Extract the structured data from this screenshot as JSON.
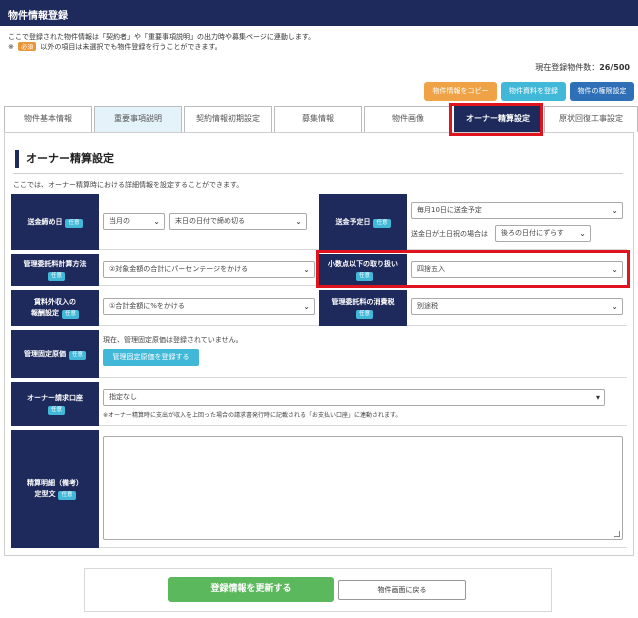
{
  "window": {
    "title": "物件情報登録"
  },
  "notes": {
    "line1": "ここで登録された物件情報は「契約者」や「重要事項説明」の出力時や募集ページに連動します。",
    "line2_prefix": "※",
    "required_badge": "必須",
    "line2_suffix": "以外の項目は未選択でも物件登録を行うことができます。"
  },
  "count": {
    "label": "現在登録物件数：",
    "value": "26/500"
  },
  "top_buttons": {
    "copy": "物件情報をコピー",
    "register": "物件資料を登録",
    "authority": "物件の権限設定"
  },
  "tabs": [
    "物件基本情報",
    "重要事項説明",
    "契約情報初期設定",
    "募集情報",
    "物件画像",
    "オーナー精算設定",
    "原状回復工事設定"
  ],
  "active_tab": "オーナー精算設定",
  "section": {
    "title": "オーナー精算設定",
    "description": "ここでは、オーナー精算時における詳細情報を設定することができます。"
  },
  "optional_badge": "任意",
  "fields": {
    "closing_day": {
      "label": "送金締め日",
      "month": "当月の",
      "day": "末日の日付で締め切る"
    },
    "scheduled_day": {
      "label": "送金予定日",
      "value": "毎月10日に送金予定",
      "holiday_text": "送金日が土日祝の場合は",
      "holiday_value": "後ろの日付にずらす"
    },
    "fee_method": {
      "label": "管理委託料計算方法",
      "value": "②対象金額の合計にパーセンテージをかける"
    },
    "rounding": {
      "label": "小数点以下の取り扱い",
      "value": "四捨五入"
    },
    "non_rent": {
      "label1": "賃料外収入の",
      "label2": "報酬設定",
      "value": "①合計金額に%をかける"
    },
    "fee_tax": {
      "label": "管理委託料の消費税",
      "value": "別途税"
    },
    "fixed_cost": {
      "label": "管理固定原価",
      "text": "現在、管理固定原価は登録されていません。",
      "button": "管理固定原価を登録する"
    },
    "bank_account": {
      "label": "オーナー請求口座",
      "value": "指定なし",
      "note": "※オーナー精算時に支出が収入を上回った場合の請求書発行時に記載される「お支払い口座」に連動されます。"
    },
    "memo": {
      "label1": "精算明細（備考）",
      "label2": "定型文"
    }
  },
  "footer": {
    "update": "登録情報を更新する",
    "back": "物件画面に戻る"
  },
  "colors": {
    "navy": "#1f2a5c",
    "cyan": "#42b8d8",
    "orange": "#efa346",
    "blue": "#2f6fb7",
    "green": "#5cb85c",
    "highlight": "#e0141e"
  }
}
